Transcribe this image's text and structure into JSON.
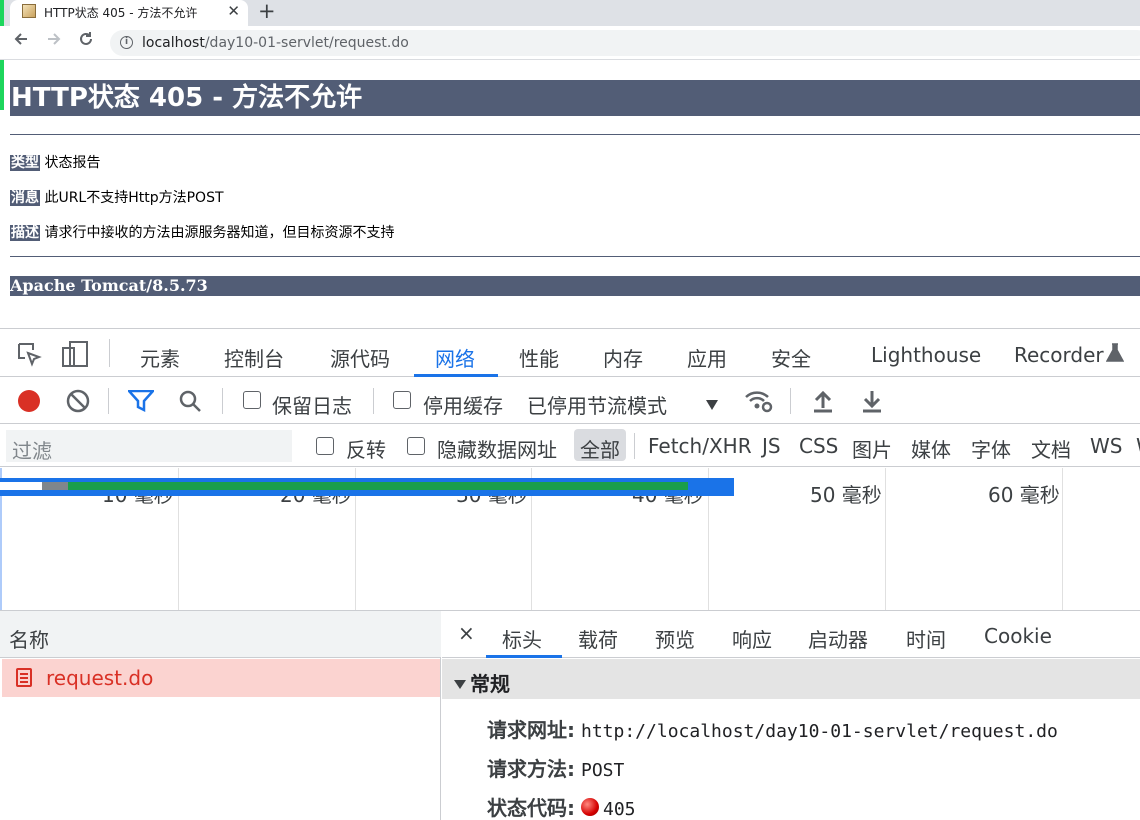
{
  "browser": {
    "tab_title": "HTTP状态 405 - 方法不允许",
    "tab_close": "✕",
    "new_tab": "+",
    "url_host": "localhost",
    "url_path": "/day10-01-servlet/request.do"
  },
  "page": {
    "title": "HTTP状态 405 - 方法不允许",
    "rows": [
      {
        "label": "类型",
        "value": "状态报告"
      },
      {
        "label": "消息",
        "value": "此URL不支持Http方法POST"
      },
      {
        "label": "描述",
        "value": "请求行中接收的方法由源服务器知道，但目标资源不支持"
      }
    ],
    "server": "Apache Tomcat/8.5.73"
  },
  "devtools": {
    "tabs": [
      "元素",
      "控制台",
      "源代码",
      "网络",
      "性能",
      "内存",
      "应用",
      "安全",
      "Lighthouse",
      "Recorder"
    ],
    "active_tab": "网络",
    "toolbar": {
      "preserve_log": "保留日志",
      "disable_cache": "停用缓存",
      "throttling": "已停用节流模式"
    },
    "filter": {
      "placeholder": "过滤",
      "invert": "反转",
      "hide_data_urls": "隐藏数据网址",
      "types": [
        "全部",
        "Fetch/XHR",
        "JS",
        "CSS",
        "图片",
        "媒体",
        "字体",
        "文档",
        "WS",
        "W"
      ],
      "active_type": "全部"
    },
    "overview": {
      "ticks": [
        "10 毫秒",
        "20 毫秒",
        "30 毫秒",
        "40 毫秒",
        "50 毫秒",
        "60 毫秒"
      ],
      "bar_colors": {
        "queue": "#ffffff",
        "stalled": "#80868b",
        "waiting": "#1a9e4b",
        "download": "#1a73e8"
      }
    },
    "requests": {
      "column": "名称",
      "items": [
        {
          "name": "request.do",
          "status": "error"
        }
      ]
    },
    "detail": {
      "tabs": [
        "标头",
        "载荷",
        "预览",
        "响应",
        "启动器",
        "时间",
        "Cookie"
      ],
      "active_tab": "标头",
      "close": "×",
      "section": "常规",
      "fields": [
        {
          "key": "请求网址:",
          "value": "http://localhost/day10-01-servlet/request.do"
        },
        {
          "key": "请求方法:",
          "value": "POST"
        },
        {
          "key": "状态代码:",
          "value": "405"
        }
      ]
    }
  }
}
